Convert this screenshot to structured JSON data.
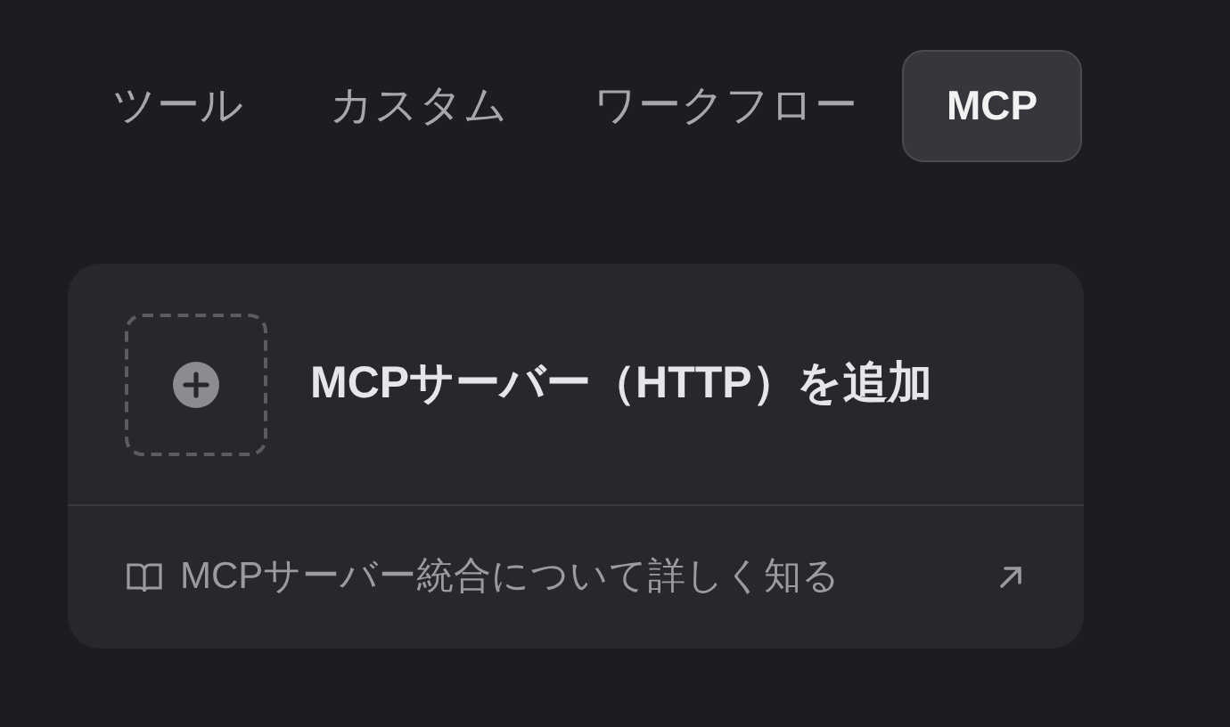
{
  "tabs": [
    {
      "label": "ツール",
      "selected": false
    },
    {
      "label": "カスタム",
      "selected": false
    },
    {
      "label": "ワークフロー",
      "selected": false
    },
    {
      "label": "MCP",
      "selected": true
    }
  ],
  "card": {
    "title": "MCPサーバー（HTTP）を追加",
    "link": "MCPサーバー統合について詳しく知る"
  }
}
